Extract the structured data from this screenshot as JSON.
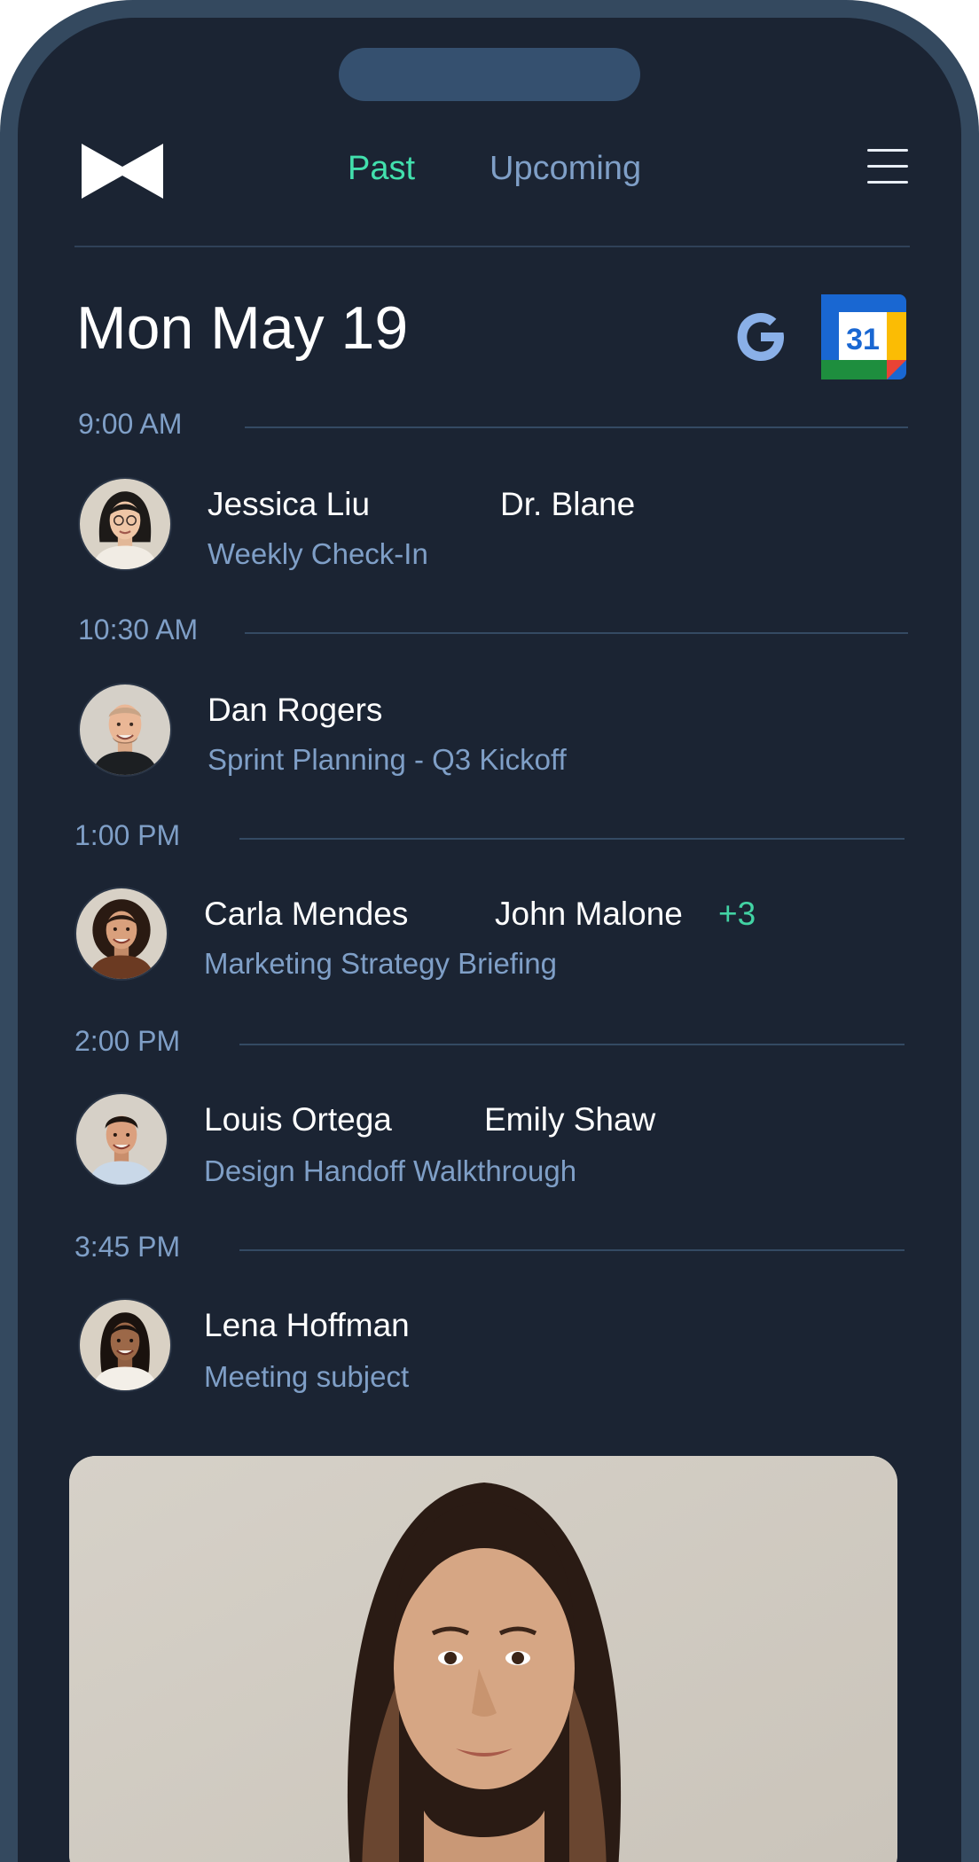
{
  "header": {
    "tabs": [
      {
        "label": "Past",
        "active": true
      },
      {
        "label": "Upcoming",
        "active": false
      }
    ],
    "logo_icon": "bowtie-logo-icon",
    "menu_icon": "hamburger-menu-icon"
  },
  "date_title": "Mon May 19",
  "integrations": {
    "google_icon": "google-g-icon",
    "calendar_icon": "google-calendar-icon",
    "calendar_day": "31"
  },
  "events": [
    {
      "time": "9:00 AM",
      "names": [
        "Jessica Liu",
        "Dr. Blane"
      ],
      "extra": "",
      "subject": "Weekly Check-In"
    },
    {
      "time": "10:30 AM",
      "names": [
        "Dan Rogers"
      ],
      "extra": "",
      "subject": "Sprint Planning - Q3 Kickoff"
    },
    {
      "time": "1:00 PM",
      "names": [
        "Carla Mendes",
        "John Malone"
      ],
      "extra": "+3",
      "subject": "Marketing Strategy Briefing"
    },
    {
      "time": "2:00 PM",
      "names": [
        "Louis Ortega",
        "Emily Shaw"
      ],
      "extra": "",
      "subject": "Design Handoff Walkthrough"
    },
    {
      "time": "3:45 PM",
      "names": [
        "Lena Hoffman"
      ],
      "extra": "",
      "subject": "Meeting subject"
    }
  ],
  "colors": {
    "background": "#1b2433",
    "frame": "#34495f",
    "accent_green": "#42e0ad",
    "muted_blue": "#7f9fc7",
    "divider": "#344a63"
  }
}
